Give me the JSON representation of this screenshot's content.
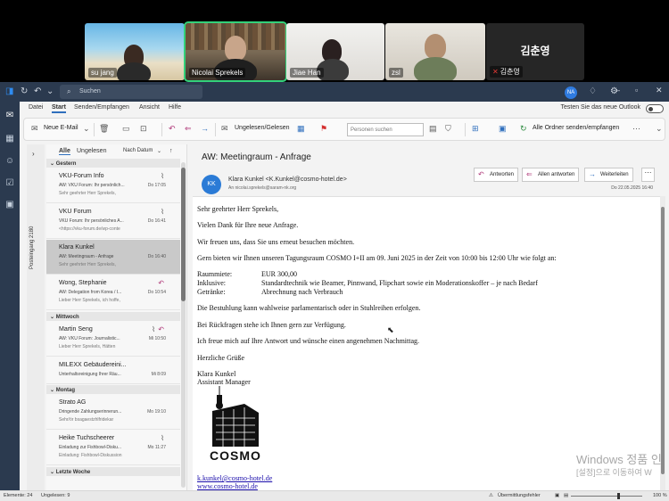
{
  "call": {
    "participants": [
      {
        "name": "su jang"
      },
      {
        "name": "Nicolai Sprekels"
      },
      {
        "name": "Jiae Han"
      },
      {
        "name": "zsl"
      },
      {
        "name": "김춘영",
        "display": "김춘영"
      }
    ]
  },
  "titlebar": {
    "search_placeholder": "Suchen",
    "user_initials": "NA"
  },
  "menu": {
    "tabs": [
      "Datei",
      "Start",
      "Senden/Empfangen",
      "Ansicht",
      "Hilfe"
    ],
    "active": "Start",
    "new_outlook_label": "Testen Sie das neue Outlook"
  },
  "ribbon": {
    "new_email": "Neue E-Mail",
    "unread_read": "Ungelesen/Gelesen",
    "people_search_placeholder": "Personen suchen",
    "sync_all": "Alle Ordner senden/empfangen"
  },
  "folderpane": {
    "label": "Posteingang  2180"
  },
  "msglist": {
    "filter_all": "Alle",
    "filter_unread": "Ungelesen",
    "sort_label": "Nach Datum",
    "groups": [
      "Gestern",
      "Mittwoch",
      "Montag",
      "Letzte Woche"
    ],
    "items": [
      {
        "from": "VKU-Forum Info",
        "subject": "AW: VKU Forum: Ihr persönlich...",
        "preview": "Sehr geehrter Herr Sprekels,",
        "time": "Do 17:05"
      },
      {
        "from": "VKU Forum",
        "subject": "VKU Forum: Ihr persönliches A...",
        "preview": "<https://vku-forum.de/wp-conte",
        "time": "Do 16:41"
      },
      {
        "from": "Klara Kunkel",
        "subject": "AW: Meetingraum - Anfrage",
        "preview": "Sehr geehrter Herr Sprekels,",
        "time": "Do 16:40"
      },
      {
        "from": "Wong, Stephanie",
        "subject": "AW: Delegation from Korea / I...",
        "preview": "Lieber Herr Sprekels,   ich hoffe,",
        "time": "Do 10:54"
      },
      {
        "from": "Martin Seng",
        "subject": "AW: VKU Forum: Journalistic...",
        "preview": "Lieber Herr Sprekels,    Hätten",
        "time": "Mi 10:50"
      },
      {
        "from": "MILEXX Gebäudereini...",
        "subject": "Unterhaltsreinigung Ihrer Räu...",
        "preview": "",
        "time": "Mi 8:09"
      },
      {
        "from": "Strato AG",
        "subject": "Dringende Zahlungserinnerun...",
        "preview": "Sehr/ör bsagaestzhlfridekar",
        "time": "Mo 19:10"
      },
      {
        "from": "Heike Tuchscheerer",
        "subject": "Einladung zur Fishbowl-Disku...",
        "preview": "Einladung: Fishbowl-Diskussion",
        "time": "Mo 11:27"
      }
    ]
  },
  "reading": {
    "subject": "AW: Meetingraum - Anfrage",
    "sender_initials": "KK",
    "sender": "Klara Kunkel <K.Kunkel@cosmo-hotel.de>",
    "recipients": "An   nicolai.sprekels@saram-nk.org",
    "date": "Do 22.05.2025 16:40",
    "buttons": {
      "reply": "Antworten",
      "reply_all": "Allen antworten",
      "forward": "Weiterleiten"
    },
    "body": {
      "salutation": "Sehr geehrter Herr Sprekels,",
      "line1": "Vielen Dank für Ihre neue Anfrage.",
      "line2": "Wir freuen uns, dass Sie uns erneut besuchen möchten.",
      "line3": "Gern bieten wir Ihnen unseren Tagungsraum COSMO I+II am 09. Juni 2025 in der Zeit von 10:00 bis 12:00 Uhr wie folgt an:",
      "rows": [
        {
          "k": "Raummiete:",
          "v": "EUR 300,00"
        },
        {
          "k": "Inklusive:",
          "v": "Standardtechnik wie Beamer, Pinnwand, Flipchart sowie ein Moderationskoffer – je nach Bedarf"
        },
        {
          "k": "Getränke:",
          "v": "Abrechnung nach Verbrauch"
        }
      ],
      "line4": "Die Bestuhlung kann wahlweise parlamentarisch oder in Stuhlreihen erfolgen.",
      "line5": "Bei Rückfragen stehe ich Ihnen gern zur Verfügung.",
      "line6": "Ich freue mich auf Ihre Antwort und wünsche einen angenehmen Nachmittag.",
      "closing": "Herzliche Grüße",
      "sig_name": "Klara Kunkel",
      "sig_title": "Assistant Manager",
      "logo_text": "COSMO",
      "email": "k.kunkel@cosmo-hotel.de",
      "web": "www.cosmo-hotel.de"
    }
  },
  "statusbar": {
    "elements": "Elemente: 24",
    "unread": "Ungelesen: 9",
    "transfer_error": "Übermittlungsfehler",
    "zoom": "100 %"
  },
  "watermark": {
    "line1": "Windows 정품 인",
    "line2": "[설정]으로 이동하여 W"
  }
}
